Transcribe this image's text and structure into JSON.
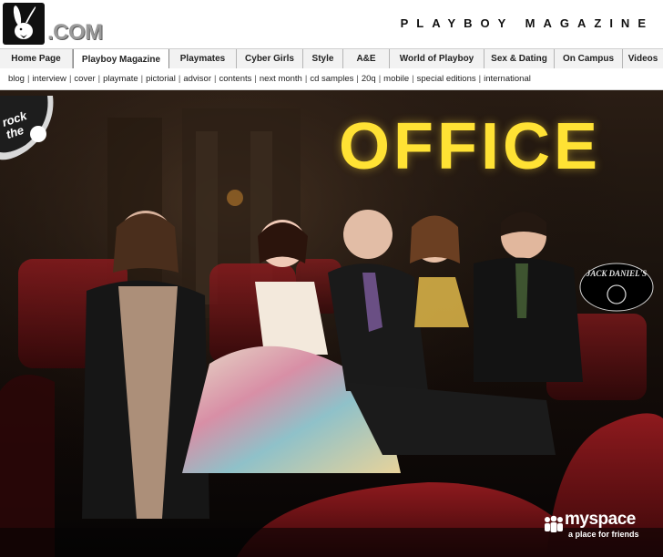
{
  "header": {
    "logo_text": ".COM",
    "site_title": "PLAYBOY MAGAZINE"
  },
  "tabs": [
    {
      "label": "Home Page",
      "active": false
    },
    {
      "label": "Playboy Magazine",
      "active": true
    },
    {
      "label": "Playmates",
      "active": false
    },
    {
      "label": "Cyber Girls",
      "active": false
    },
    {
      "label": "Style",
      "active": false
    },
    {
      "label": "A&E",
      "active": false
    },
    {
      "label": "World of Playboy",
      "active": false
    },
    {
      "label": "Sex & Dating",
      "active": false
    },
    {
      "label": "On Campus",
      "active": false
    },
    {
      "label": "Videos",
      "active": false
    }
  ],
  "subnav": [
    "blog",
    "interview",
    "cover",
    "playmate",
    "pictorial",
    "advisor",
    "contents",
    "next month",
    "cd samples",
    "20q",
    "mobile",
    "special editions",
    "international"
  ],
  "hero": {
    "band_name": "OFFICE",
    "badge_text": "rock the",
    "sponsor_text": "JACK DANIEL'S",
    "myspace_name": "myspace",
    "myspace_tagline": "a place for friends"
  },
  "colors": {
    "marquee": "#ffe234",
    "tab_active_bg": "#ffffff",
    "tab_bg": "#f2f2f2"
  }
}
